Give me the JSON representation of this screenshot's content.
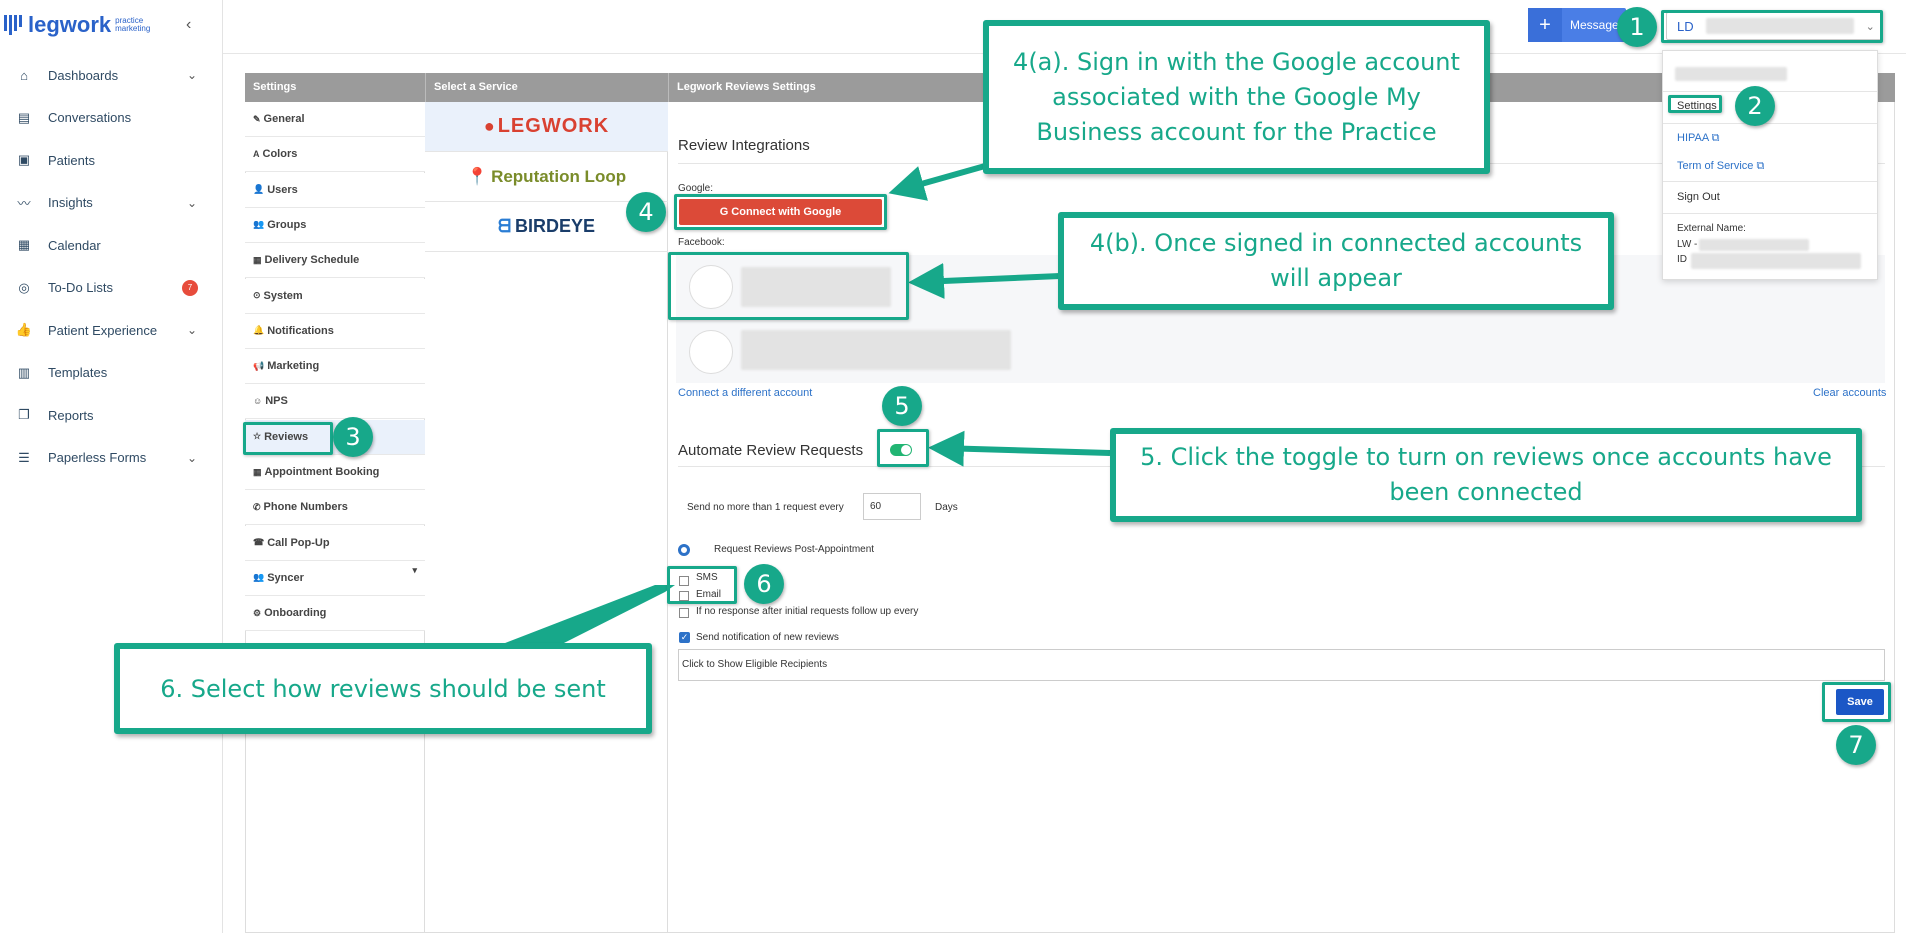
{
  "brand": {
    "word": "legwork",
    "sub1": "practice",
    "sub2": "marketing"
  },
  "nav": [
    {
      "label": "Dashboards",
      "icon": "home-icon",
      "chevron": true
    },
    {
      "label": "Conversations",
      "icon": "chat-icon"
    },
    {
      "label": "Patients",
      "icon": "patients-icon"
    },
    {
      "label": "Insights",
      "icon": "insights-icon",
      "chevron": true
    },
    {
      "label": "Calendar",
      "icon": "calendar-icon"
    },
    {
      "label": "To-Do Lists",
      "icon": "check-circle-icon",
      "badge": "7"
    },
    {
      "label": "Patient Experience",
      "icon": "thumbs-up-icon",
      "chevron": true
    },
    {
      "label": "Templates",
      "icon": "templates-icon"
    },
    {
      "label": "Reports",
      "icon": "reports-icon"
    },
    {
      "label": "Paperless Forms",
      "icon": "forms-icon",
      "chevron": true
    }
  ],
  "topbar": {
    "message_label": "Message",
    "user_initials": "LD"
  },
  "dropdown": {
    "settings": "Settings",
    "hipaa": "HIPAA",
    "terms": "Term of Service",
    "signout": "Sign Out",
    "external_name": "External Name:",
    "lw": "LW -",
    "id": "ID"
  },
  "headers": {
    "settings": "Settings",
    "service": "Select a Service",
    "reviews": "Legwork Reviews Settings"
  },
  "settings_items": [
    "General",
    "Colors",
    "Users",
    "Groups",
    "Delivery Schedule",
    "System",
    "Notifications",
    "Marketing",
    "NPS",
    "Reviews",
    "Appointment Booking",
    "Phone Numbers",
    "Call Pop-Up",
    "Syncer",
    "Onboarding"
  ],
  "services": [
    "LEGWORK",
    "Reputation Loop",
    "BIRDEYE"
  ],
  "main": {
    "review_integrations": "Review Integrations",
    "google_label": "Google:",
    "connect_google": "Connect with Google",
    "facebook_label": "Facebook:",
    "connect_different": "Connect a different account",
    "clear_accounts": "Clear accounts",
    "automate": "Automate Review Requests",
    "send_no_more": "Send no more than 1 request every",
    "days_value": "60",
    "days": "Days",
    "post_appt": "Request Reviews Post-Appointment",
    "sms": "SMS",
    "email": "Email",
    "no_response": "If no response after initial requests follow up every",
    "send_notification": "Send notification of new reviews",
    "eligible": "Click to Show Eligible Recipients",
    "save": "Save"
  },
  "annotations": {
    "a4a": "4(a). Sign in with the Google account associated with the Google My Business account for the Practice",
    "a4b": "4(b). Once signed in connected accounts will appear",
    "a5": "5. Click the toggle to turn on reviews once accounts have been connected",
    "a6": "6. Select how reviews should be sent",
    "n1": "1",
    "n2": "2",
    "n3": "3",
    "n4": "4",
    "n5": "5",
    "n6": "6",
    "n7": "7"
  },
  "colors": {
    "accent": "#17a88a",
    "brand": "#2a62c9",
    "google": "#dc4a38",
    "save": "#1b57c6"
  }
}
